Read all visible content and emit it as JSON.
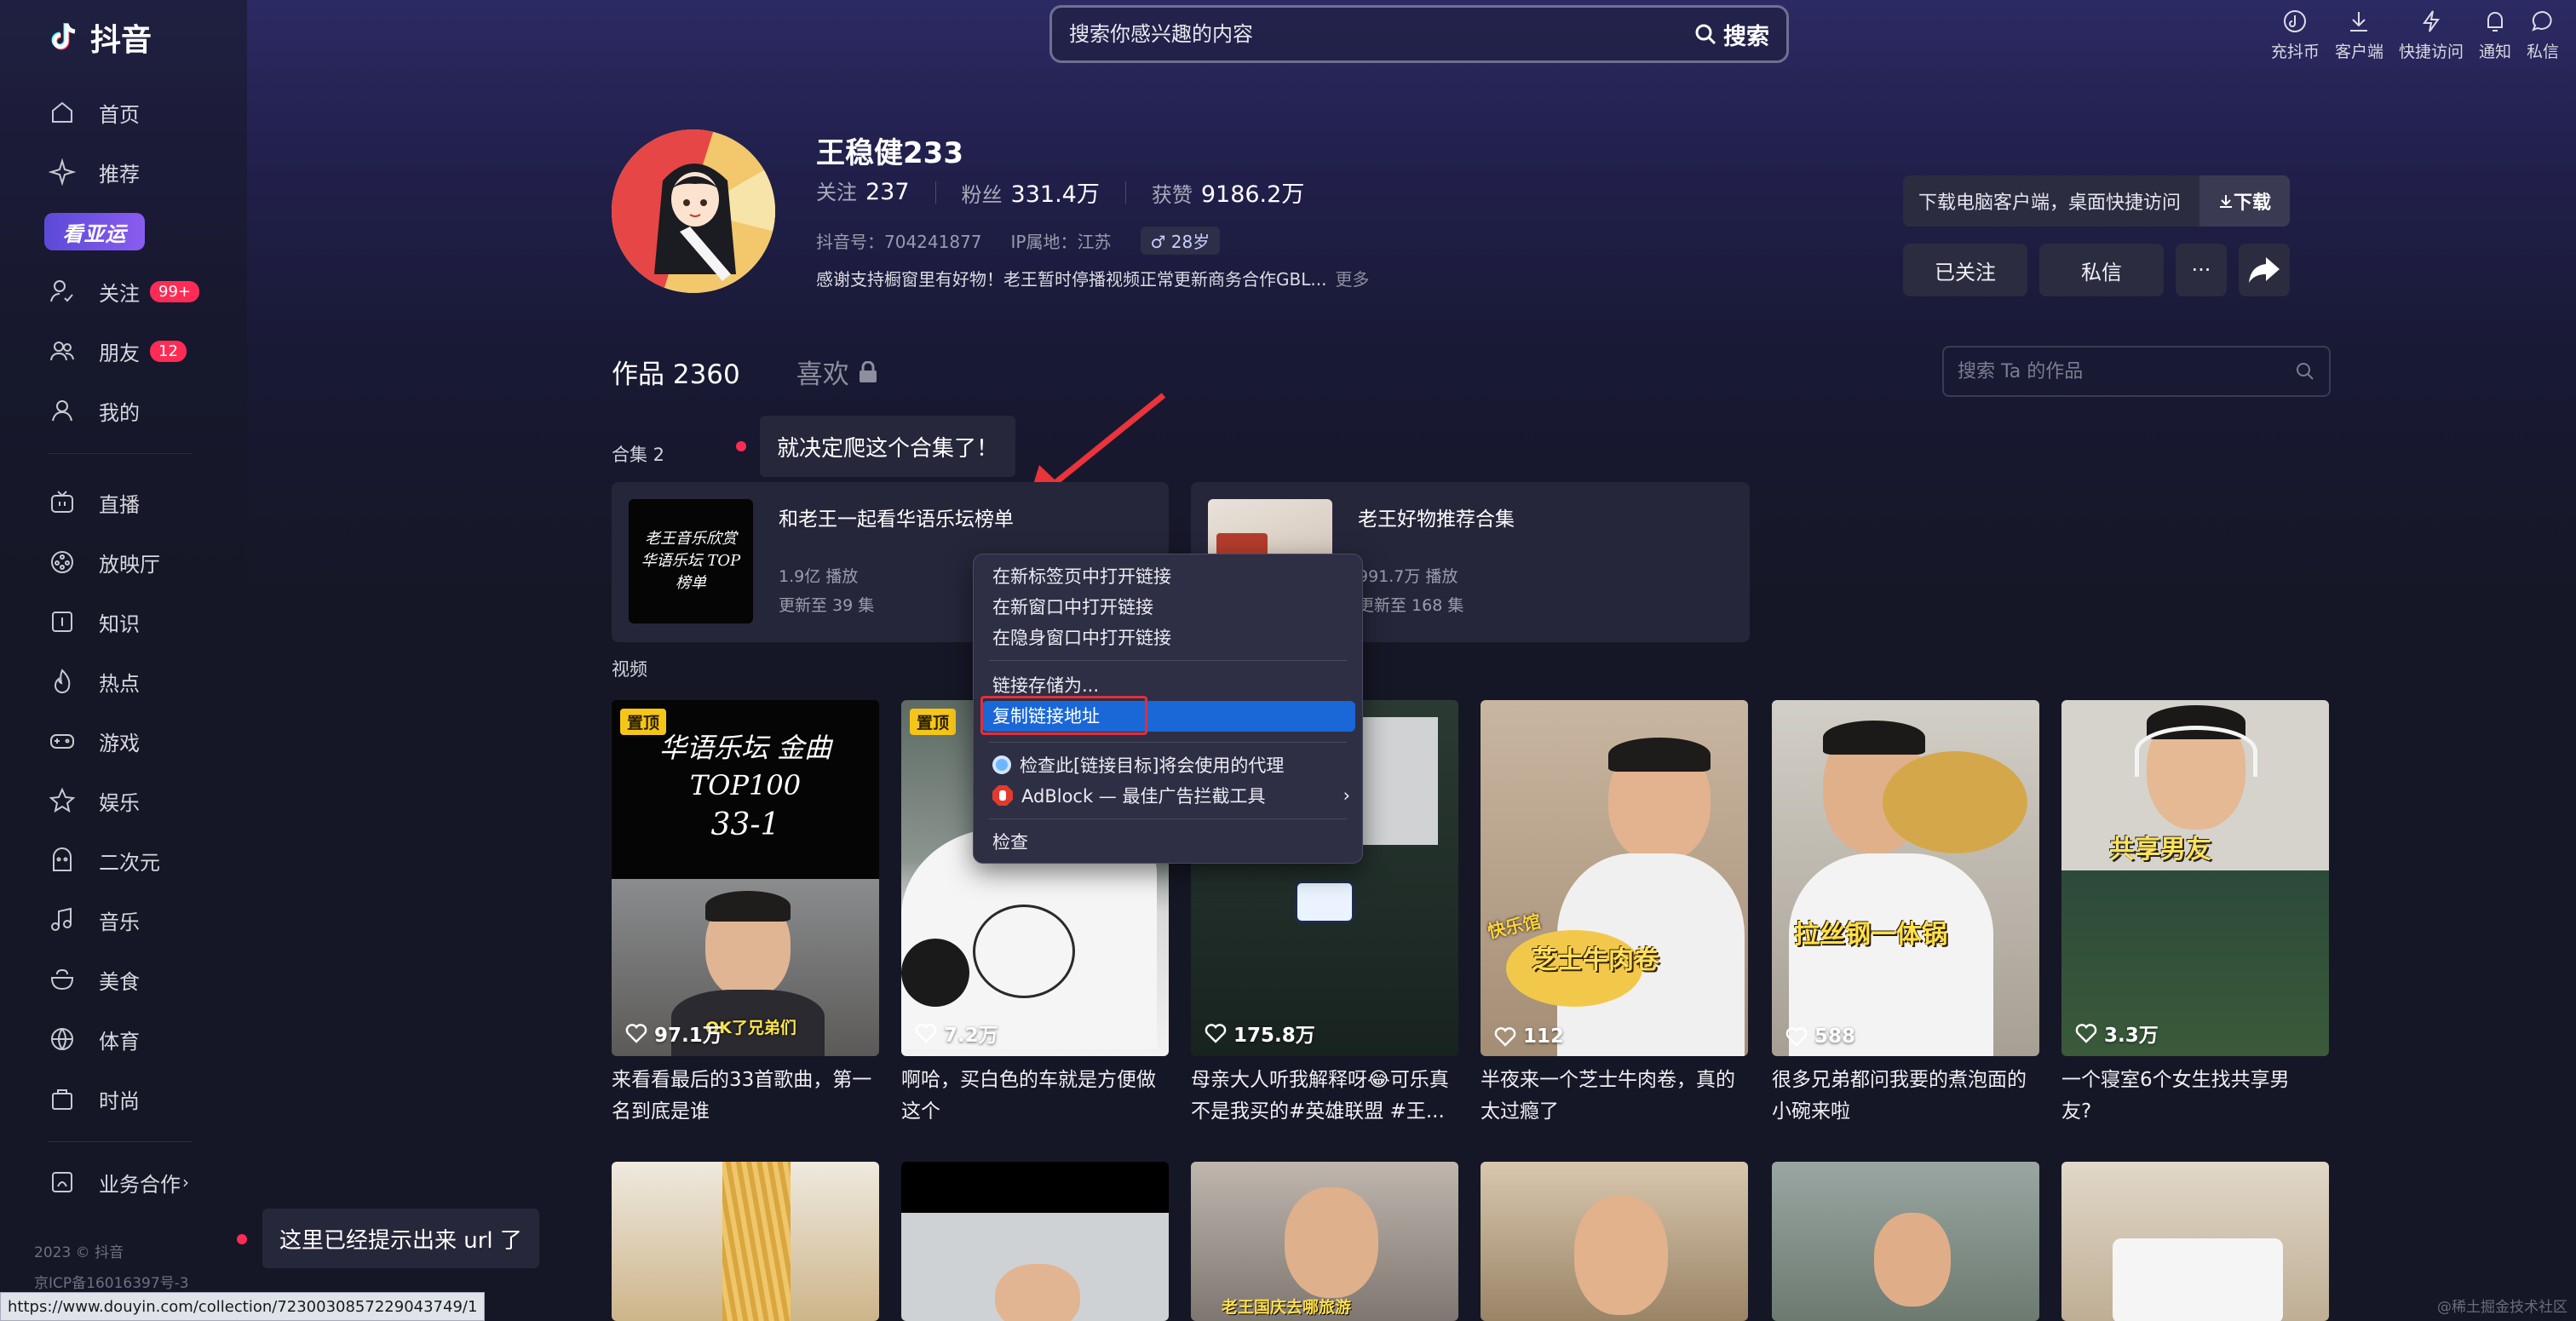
{
  "brand": {
    "name": "抖音"
  },
  "search": {
    "placeholder": "搜索你感兴趣的内容",
    "button": "搜索"
  },
  "top_actions": [
    {
      "label": "充抖币",
      "icon": "coin-icon"
    },
    {
      "label": "客户端",
      "icon": "download-icon"
    },
    {
      "label": "快捷访问",
      "icon": "lightning-icon"
    },
    {
      "label": "通知",
      "icon": "bell-icon"
    },
    {
      "label": "私信",
      "icon": "message-icon"
    }
  ],
  "sidebar": {
    "items": [
      {
        "label": "首页",
        "icon": "home-icon"
      },
      {
        "label": "推荐",
        "icon": "sparkle-icon"
      },
      {
        "label": "关注",
        "icon": "follow-icon",
        "badge": "99+"
      },
      {
        "label": "朋友",
        "icon": "friends-icon",
        "badge": "12"
      },
      {
        "label": "我的",
        "icon": "user-icon"
      },
      {
        "label": "直播",
        "icon": "live-tv-icon"
      },
      {
        "label": "放映厅",
        "icon": "cinema-icon"
      },
      {
        "label": "知识",
        "icon": "knowledge-icon"
      },
      {
        "label": "热点",
        "icon": "fire-icon"
      },
      {
        "label": "游戏",
        "icon": "gamepad-icon"
      },
      {
        "label": "娱乐",
        "icon": "star-icon"
      },
      {
        "label": "二次元",
        "icon": "anime-icon"
      },
      {
        "label": "音乐",
        "icon": "music-note-icon"
      },
      {
        "label": "美食",
        "icon": "food-icon"
      },
      {
        "label": "体育",
        "icon": "ball-icon"
      },
      {
        "label": "时尚",
        "icon": "bag-icon"
      }
    ],
    "olympic_banner": "看亚运",
    "business": "业务合作",
    "footer_copyright": "2023 © 抖音",
    "footer_icp": "京ICP备16016397号-3"
  },
  "profile": {
    "name": "王稳健233",
    "following_label": "关注",
    "following": "237",
    "fans_label": "粉丝",
    "fans": "331.4万",
    "likes_label": "获赞",
    "likes": "9186.2万",
    "douyin_id": "抖音号：704241877",
    "ip": "IP属地：江苏",
    "age": "♂ 28岁",
    "bio": "感谢支持橱窗里有好物！老王暂时停播视频正常更新商务合作GBL...",
    "bio_more": "更多"
  },
  "actions": {
    "download_hint": "下载电脑客户端，桌面快捷访问",
    "download_btn": "下载",
    "followed": "已关注",
    "message": "私信",
    "more": "···"
  },
  "tabs": {
    "works": "作品 2360",
    "likes": "喜欢"
  },
  "works_search": {
    "placeholder": "搜索 Ta 的作品"
  },
  "collections": {
    "label": "合集 2",
    "items": [
      {
        "title": "和老王一起看华语乐坛榜单",
        "plays": "1.9亿 播放",
        "updated": "更新至 39 集",
        "thumb_text": "老王音乐欣赏 华语乐坛 TOP榜单"
      },
      {
        "title": "老王好物推荐合集",
        "plays": "991.7万 播放",
        "updated": "更新至 168 集"
      }
    ]
  },
  "tooltips": {
    "collection": "就决定爬这个合集了！",
    "url": "这里已经提示出来 url 了"
  },
  "videos_label": "视频",
  "videos": [
    {
      "likes": "97.1万",
      "title_line1": "来看看最后的33首歌曲，第一",
      "title_line2": "名到底是谁",
      "pinned": "置顶",
      "overlay_text": "华语乐坛 金曲TOP100",
      "overlay_text2": "33-1",
      "caption": "OK了兄弟们"
    },
    {
      "likes": "7.2万",
      "title_line1": "啊哈，买白色的车就是方便做",
      "title_line2": "这个",
      "pinned": "置顶"
    },
    {
      "likes": "175.8万",
      "title_line1": "母亲大人听我解释呀😂可乐真",
      "title_line2": "不是我买的#英雄联盟 #王..."
    },
    {
      "likes": "112",
      "title_line1": "半夜来一个芝士牛肉卷，真的",
      "title_line2": "太过瘾了",
      "overlay_text": "芝士牛肉卷",
      "overlay_tag": "快乐馆"
    },
    {
      "likes": "588",
      "title_line1": "很多兄弟都问我要的煮泡面的",
      "title_line2": "小碗来啦",
      "overlay_text": "拉丝钢一体锅"
    },
    {
      "likes": "3.3万",
      "title_line1": "一个寝室6个女生找共享男",
      "title_line2": "友?",
      "overlay_text": "共享男友"
    }
  ],
  "row2_caption": "老王国庆去哪旅游",
  "context_menu": {
    "items": [
      "在新标签页中打开链接",
      "在新窗口中打开链接",
      "在隐身窗口中打开链接",
      "链接存储为...",
      "复制链接地址",
      "检查此[链接目标]将会使用的代理",
      "AdBlock — 最佳广告拦截工具",
      "检查"
    ]
  },
  "status_url": "https://www.douyin.com/collection/7230030857229043749/1",
  "watermark": "@稀土掘金技术社区",
  "colors": {
    "accent": "#fe2c55",
    "highlight": "#1a67d8",
    "pin": "#f5c518",
    "annotation": "#e0303a"
  }
}
